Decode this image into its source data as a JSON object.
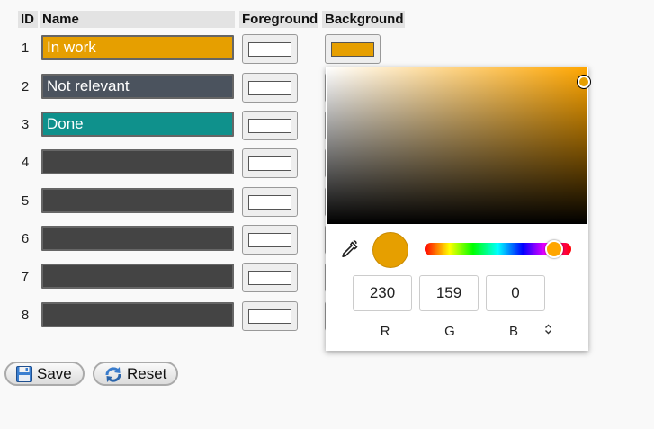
{
  "table": {
    "headers": {
      "id": "ID",
      "name": "Name",
      "foreground": "Foreground",
      "background": "Background"
    },
    "rows": [
      {
        "id": "1",
        "name": "In work",
        "color": "#e69f00"
      },
      {
        "id": "2",
        "name": "Not relevant",
        "color": "#4b535e"
      },
      {
        "id": "3",
        "name": "Done",
        "color": "#0f918c"
      },
      {
        "id": "4",
        "name": "",
        "color": "#444444"
      },
      {
        "id": "5",
        "name": "",
        "color": "#444444"
      },
      {
        "id": "6",
        "name": "",
        "color": "#444444"
      },
      {
        "id": "7",
        "name": "",
        "color": "#444444"
      },
      {
        "id": "8",
        "name": "",
        "color": "#444444"
      }
    ]
  },
  "picker": {
    "selected_color": "#e69f00",
    "hue_color": "#ffa600",
    "r": "230",
    "g": "159",
    "b": "0",
    "label_r": "R",
    "label_g": "G",
    "label_b": "B",
    "eyedropper_icon": "eyedropper-icon",
    "toggle_icon": "up-down-chevron-icon"
  },
  "buttons": {
    "save": "Save",
    "reset": "Reset"
  }
}
